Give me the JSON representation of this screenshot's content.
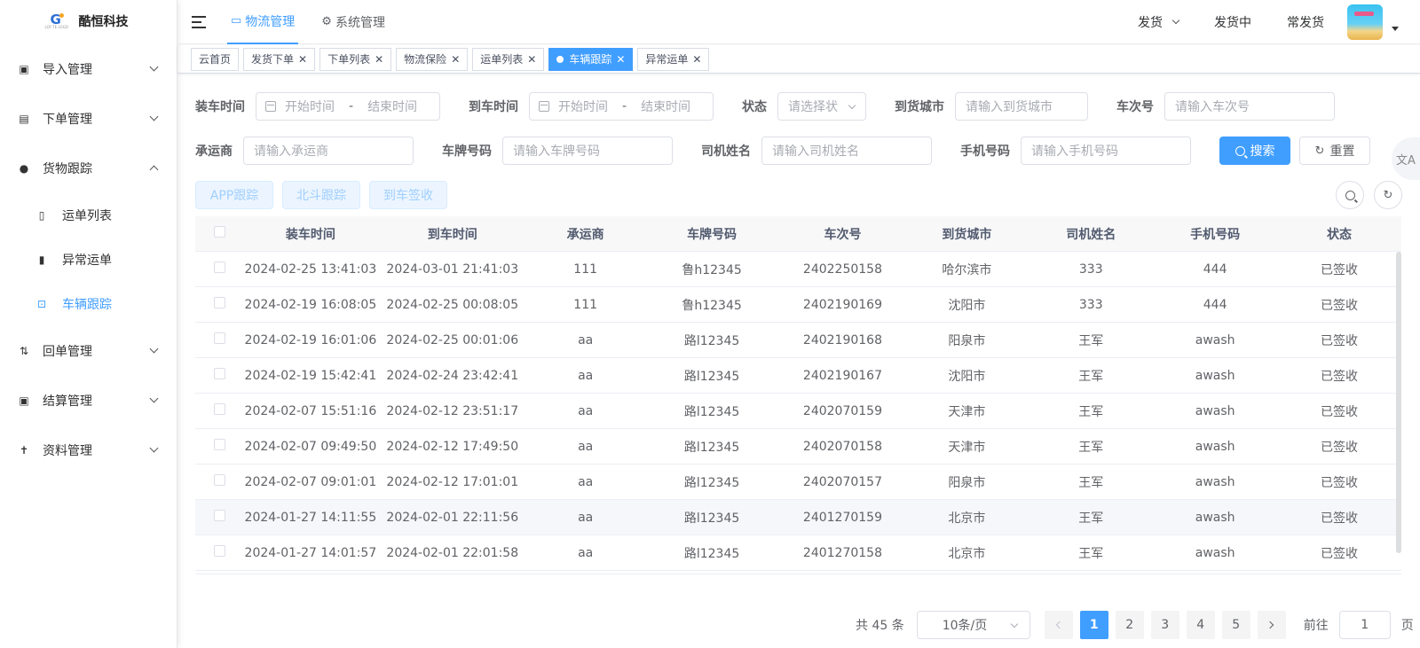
{
  "brand": {
    "name": "酷恒科技",
    "logo_small": "LOY TE LOGO"
  },
  "sidebar": {
    "items": [
      {
        "label": "导入管理",
        "icon": "import-icon",
        "expanded": false
      },
      {
        "label": "下单管理",
        "icon": "order-icon",
        "expanded": false
      },
      {
        "label": "货物跟踪",
        "icon": "location-icon",
        "expanded": true,
        "children": [
          {
            "label": "运单列表",
            "icon": "document-icon",
            "active": false
          },
          {
            "label": "异常运单",
            "icon": "exception-icon",
            "active": false
          },
          {
            "label": "车辆跟踪",
            "icon": "vehicle-track-icon",
            "active": true
          }
        ]
      },
      {
        "label": "回单管理",
        "icon": "receipt-icon",
        "expanded": false
      },
      {
        "label": "结算管理",
        "icon": "settlement-icon",
        "expanded": false
      },
      {
        "label": "资料管理",
        "icon": "profile-icon",
        "expanded": false
      }
    ]
  },
  "header": {
    "tabs": [
      {
        "label": "物流管理",
        "icon": "monitor-icon",
        "active": true
      },
      {
        "label": "系统管理",
        "icon": "gear-icon",
        "active": false
      }
    ],
    "right": {
      "ship": "发货",
      "shipping": "发货中",
      "frequent": "常发货"
    }
  },
  "tags": [
    {
      "label": "云首页",
      "closable": false,
      "active": false
    },
    {
      "label": "发货下单",
      "closable": true,
      "active": false
    },
    {
      "label": "下单列表",
      "closable": true,
      "active": false
    },
    {
      "label": "物流保险",
      "closable": true,
      "active": false
    },
    {
      "label": "运单列表",
      "closable": true,
      "active": false
    },
    {
      "label": "车辆跟踪",
      "closable": true,
      "active": true
    },
    {
      "label": "异常运单",
      "closable": true,
      "active": false
    }
  ],
  "filters": {
    "load_time": {
      "label": "装车时间",
      "start": "开始时间",
      "sep": "-",
      "end": "结束时间"
    },
    "arrive_time": {
      "label": "到车时间",
      "start": "开始时间",
      "sep": "-",
      "end": "结束时间"
    },
    "status": {
      "label": "状态",
      "placeholder": "请选择状"
    },
    "city": {
      "label": "到货城市",
      "placeholder": "请输入到货城市"
    },
    "trip": {
      "label": "车次号",
      "placeholder": "请输入车次号"
    },
    "carrier": {
      "label": "承运商",
      "placeholder": "请输入承运商"
    },
    "plate": {
      "label": "车牌号码",
      "placeholder": "请输入车牌号码"
    },
    "driver": {
      "label": "司机姓名",
      "placeholder": "请输入司机姓名"
    },
    "phone": {
      "label": "手机号码",
      "placeholder": "请输入手机号码"
    },
    "search_btn": "搜索",
    "reset_btn": "重置"
  },
  "actions": {
    "app_track": "APP跟踪",
    "beidou_track": "北斗跟踪",
    "arrive_sign": "到车签收"
  },
  "table": {
    "columns": [
      "装车时间",
      "到车时间",
      "承运商",
      "车牌号码",
      "车次号",
      "到货城市",
      "司机姓名",
      "手机号码",
      "状态"
    ],
    "rows": [
      [
        "2024-02-25 13:41:03",
        "2024-03-01 21:41:03",
        "111",
        "鲁h12345",
        "2402250158",
        "哈尔滨市",
        "333",
        "444",
        "已签收"
      ],
      [
        "2024-02-19 16:08:05",
        "2024-02-25 00:08:05",
        "111",
        "鲁h12345",
        "2402190169",
        "沈阳市",
        "333",
        "444",
        "已签收"
      ],
      [
        "2024-02-19 16:01:06",
        "2024-02-25 00:01:06",
        "aa",
        "路l12345",
        "2402190168",
        "阳泉市",
        "王军",
        "awash",
        "已签收"
      ],
      [
        "2024-02-19 15:42:41",
        "2024-02-24 23:42:41",
        "aa",
        "路l12345",
        "2402190167",
        "沈阳市",
        "王军",
        "awash",
        "已签收"
      ],
      [
        "2024-02-07 15:51:16",
        "2024-02-12 23:51:17",
        "aa",
        "路l12345",
        "2402070159",
        "天津市",
        "王军",
        "awash",
        "已签收"
      ],
      [
        "2024-02-07 09:49:50",
        "2024-02-12 17:49:50",
        "aa",
        "路l12345",
        "2402070158",
        "天津市",
        "王军",
        "awash",
        "已签收"
      ],
      [
        "2024-02-07 09:01:01",
        "2024-02-12 17:01:01",
        "aa",
        "路l12345",
        "2402070157",
        "阳泉市",
        "王军",
        "awash",
        "已签收"
      ],
      [
        "2024-01-27 14:11:55",
        "2024-02-01 22:11:56",
        "aa",
        "路l12345",
        "2401270159",
        "北京市",
        "王军",
        "awash",
        "已签收"
      ],
      [
        "2024-01-27 14:01:57",
        "2024-02-01 22:01:58",
        "aa",
        "路l12345",
        "2401270158",
        "北京市",
        "王军",
        "awash",
        "已签收"
      ]
    ]
  },
  "pagination": {
    "total": "共 45 条",
    "page_size": "10条/页",
    "pages": [
      "1",
      "2",
      "3",
      "4",
      "5"
    ],
    "current": "1",
    "goto_label": "前往",
    "goto_value": "1",
    "page_unit": "页"
  },
  "colors": {
    "primary": "#409eff",
    "text": "#303133",
    "muted": "#a8abb2"
  }
}
